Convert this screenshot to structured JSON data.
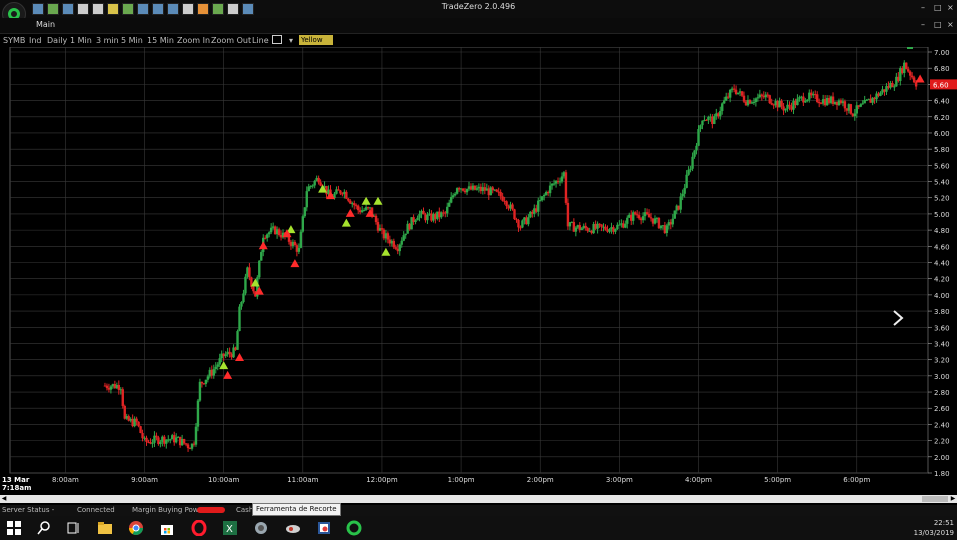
{
  "app": {
    "title": "TradeZero 2.0.496",
    "window_controls": [
      "–",
      "□",
      "×"
    ]
  },
  "menu": {
    "main": "Main",
    "controls": [
      "–",
      "□",
      "×"
    ]
  },
  "toolbar": {
    "symbol": "SYMB",
    "ind": "Ind",
    "daily": "Daily",
    "m1": "1 Min",
    "m3": "3 min",
    "m5": "5 Min",
    "m15": "15 Min",
    "zoom_in": "Zoom In",
    "zoom_out": "Zoom Out",
    "line": "Line",
    "color": "Yellow"
  },
  "status": {
    "server_label": "Server Status -",
    "connected": "Connected",
    "margin_label": "Margin Buying Power:",
    "cash_label": "Cash"
  },
  "tooltip": "Ferramenta de Recorte",
  "clock": {
    "time": "22:51",
    "date": "13/03/2019"
  },
  "colors": {
    "up": "#2fa84a",
    "down": "#e02424",
    "buy_marker": "#a6e22e",
    "sell_marker": "#ff2b2b",
    "grid": "#3a3a3a"
  },
  "chart_data": {
    "type": "candlestick",
    "date_label": [
      "13 Mar",
      "7:18am"
    ],
    "x_tick_labels": [
      "8:00am",
      "9:00am",
      "10:00am",
      "11:00am",
      "12:00pm",
      "1:00pm",
      "2:00pm",
      "3:00pm",
      "4:00pm",
      "5:00pm",
      "6:00pm"
    ],
    "x_ticks_hours": [
      8,
      9,
      10,
      11,
      12,
      13,
      14,
      15,
      16,
      17,
      18
    ],
    "y_tick_labels": [
      "1.80",
      "2.00",
      "2.20",
      "2.40",
      "2.60",
      "2.80",
      "3.00",
      "3.20",
      "3.40",
      "3.60",
      "3.80",
      "4.00",
      "4.20",
      "4.40",
      "4.60",
      "4.80",
      "5.00",
      "5.20",
      "5.40",
      "5.60",
      "5.80",
      "6.00",
      "6.20",
      "6.40",
      "6.60",
      "6.80",
      "7.00"
    ],
    "ylim": [
      1.8,
      7.0
    ],
    "xlim_hours": [
      7.3,
      18.9
    ],
    "last_price": "6.60",
    "price_path": [
      [
        8.5,
        2.88
      ],
      [
        8.7,
        2.88
      ],
      [
        8.75,
        2.45
      ],
      [
        8.9,
        2.42
      ],
      [
        9.0,
        2.18
      ],
      [
        9.2,
        2.22
      ],
      [
        9.4,
        2.22
      ],
      [
        9.55,
        2.14
      ],
      [
        9.62,
        2.15
      ],
      [
        9.7,
        2.9
      ],
      [
        9.85,
        3.05
      ],
      [
        10.0,
        3.25
      ],
      [
        10.15,
        3.3
      ],
      [
        10.2,
        3.8
      ],
      [
        10.3,
        4.3
      ],
      [
        10.4,
        4.0
      ],
      [
        10.5,
        4.75
      ],
      [
        10.65,
        4.8
      ],
      [
        10.8,
        4.7
      ],
      [
        10.95,
        4.55
      ],
      [
        11.05,
        5.3
      ],
      [
        11.2,
        5.45
      ],
      [
        11.35,
        5.2
      ],
      [
        11.5,
        5.3
      ],
      [
        11.7,
        5.05
      ],
      [
        11.85,
        5.05
      ],
      [
        12.0,
        4.75
      ],
      [
        12.2,
        4.6
      ],
      [
        12.3,
        4.8
      ],
      [
        12.45,
        5.0
      ],
      [
        12.6,
        4.95
      ],
      [
        12.8,
        5.0
      ],
      [
        12.95,
        5.35
      ],
      [
        13.1,
        5.3
      ],
      [
        13.3,
        5.3
      ],
      [
        13.55,
        5.2
      ],
      [
        13.75,
        4.85
      ],
      [
        13.9,
        5.0
      ],
      [
        14.1,
        5.3
      ],
      [
        14.3,
        5.5
      ],
      [
        14.35,
        4.85
      ],
      [
        14.55,
        4.82
      ],
      [
        14.8,
        4.82
      ],
      [
        15.0,
        4.85
      ],
      [
        15.2,
        5.0
      ],
      [
        15.4,
        4.95
      ],
      [
        15.6,
        4.8
      ],
      [
        15.75,
        5.1
      ],
      [
        15.9,
        5.6
      ],
      [
        16.05,
        6.2
      ],
      [
        16.2,
        6.15
      ],
      [
        16.3,
        6.35
      ],
      [
        16.45,
        6.55
      ],
      [
        16.6,
        6.4
      ],
      [
        16.85,
        6.45
      ],
      [
        17.1,
        6.3
      ],
      [
        17.35,
        6.45
      ],
      [
        17.6,
        6.4
      ],
      [
        17.8,
        6.4
      ],
      [
        17.95,
        6.25
      ],
      [
        18.1,
        6.35
      ],
      [
        18.3,
        6.5
      ],
      [
        18.5,
        6.65
      ],
      [
        18.6,
        6.85
      ],
      [
        18.75,
        6.62
      ]
    ],
    "buy_markers": [
      [
        10.0,
        3.12
      ],
      [
        10.4,
        4.14
      ],
      [
        10.85,
        4.8
      ],
      [
        11.25,
        5.3
      ],
      [
        11.55,
        4.88
      ],
      [
        11.8,
        5.15
      ],
      [
        11.95,
        5.15
      ],
      [
        12.05,
        4.52
      ]
    ],
    "sell_markers": [
      [
        10.05,
        3.0
      ],
      [
        10.2,
        3.22
      ],
      [
        10.45,
        4.04
      ],
      [
        10.5,
        4.6
      ],
      [
        10.8,
        4.75
      ],
      [
        10.9,
        4.38
      ],
      [
        11.35,
        5.22
      ],
      [
        11.6,
        5.0
      ],
      [
        11.85,
        5.0
      ],
      [
        18.8,
        6.66
      ]
    ]
  }
}
